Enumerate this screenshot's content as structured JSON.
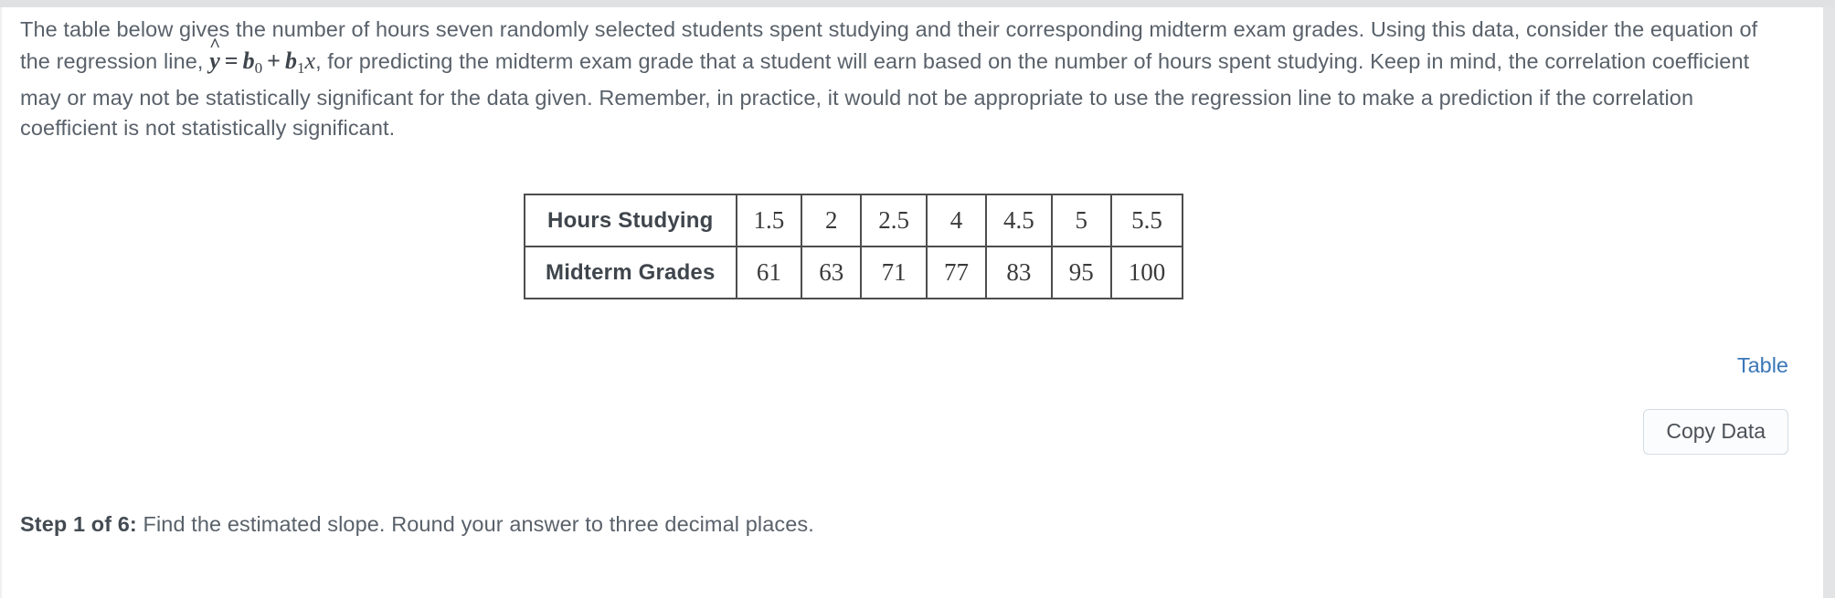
{
  "problem": {
    "text_part1": "The table below gives the number of hours seven randomly selected students spent studying and their corresponding midterm exam grades. Using this data, consider the equation of the regression line, ",
    "equation": {
      "y_hat": "y",
      "hat_symbol": "^",
      "equals": "=",
      "b0": "b",
      "b0_sub": "0",
      "plus": "+",
      "b1": "b",
      "b1_sub": "1",
      "x": "x",
      "plain": "ŷ = b₀ + b₁x"
    },
    "text_part2": ", for predicting the midterm exam grade that a student will earn based on the number of hours spent studying. Keep in mind, the correlation coefficient may or may not be statistically significant for the data given. Remember, in practice, it would not be appropriate to use the regression line to make a prediction if the correlation coefficient is not statistically significant."
  },
  "data_table": {
    "rows": [
      {
        "label": "Hours Studying",
        "values": [
          "1.5",
          "2",
          "2.5",
          "4",
          "4.5",
          "5",
          "5.5"
        ]
      },
      {
        "label": "Midterm Grades",
        "values": [
          "61",
          "63",
          "71",
          "77",
          "83",
          "95",
          "100"
        ]
      }
    ]
  },
  "actions": {
    "table_link": "Table",
    "copy_data_button": "Copy Data"
  },
  "step": {
    "label": "Step 1 of 6:",
    "instruction": "Find the estimated slope. Round your answer to three decimal places."
  },
  "colors": {
    "body_text": "#59616a",
    "link_blue": "#3a77b8",
    "table_border": "#4d4d4d",
    "button_border": "#d3dce4",
    "button_bg": "#fbfcfd",
    "page_bg": "#ffffff",
    "gutter_grey": "#e0e1e2"
  }
}
